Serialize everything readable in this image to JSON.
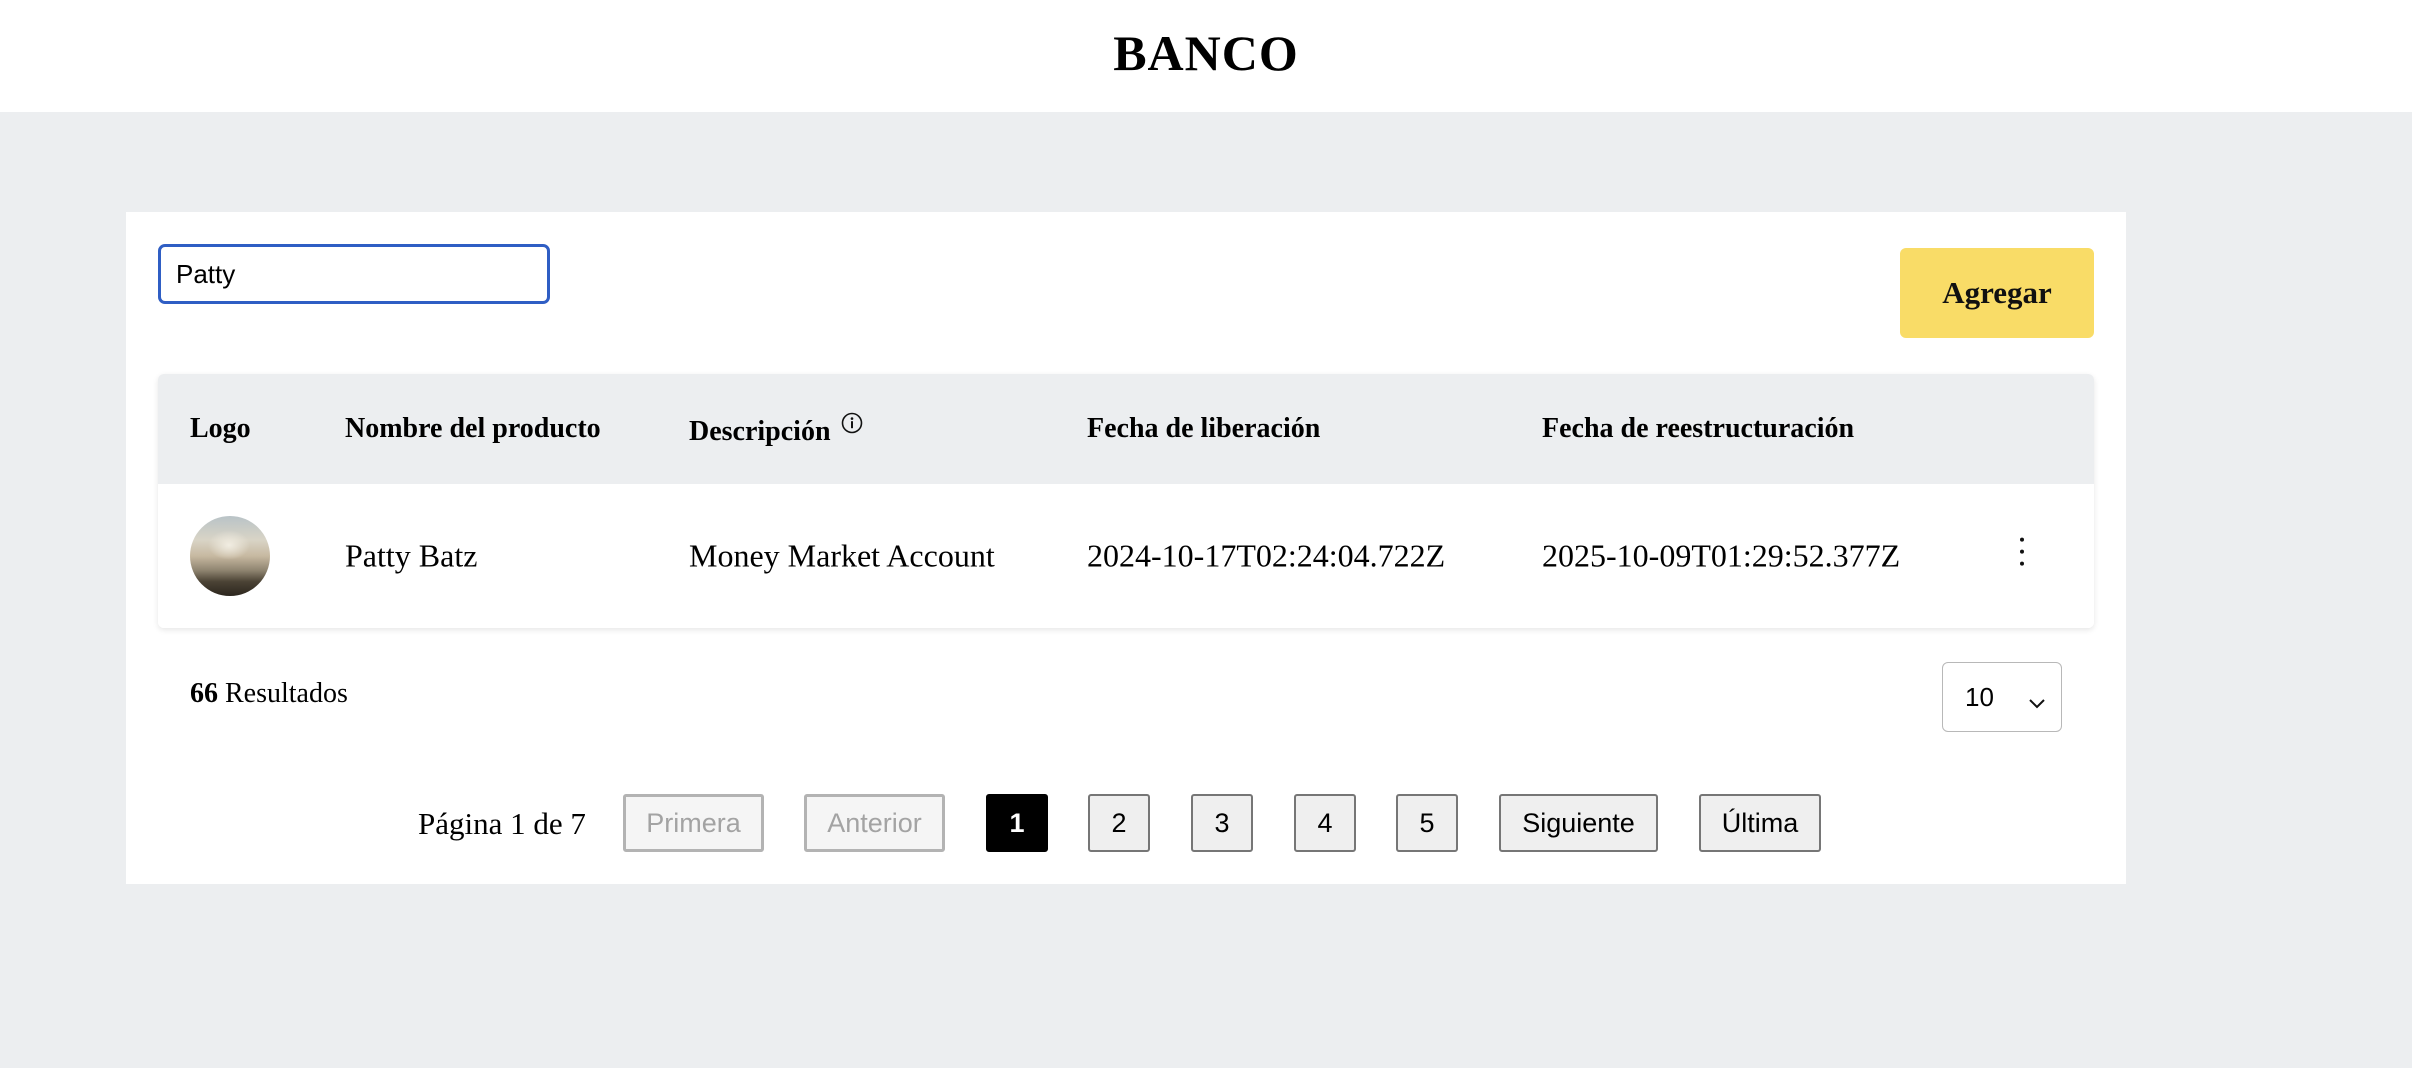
{
  "header": {
    "brand": "BANCO"
  },
  "search": {
    "value": "Patty",
    "placeholder": ""
  },
  "toolbar": {
    "add_label": "Agregar"
  },
  "table": {
    "columns": {
      "logo": "Logo",
      "name": "Nombre del producto",
      "description": "Descripción",
      "release_date": "Fecha de liberación",
      "restructure_date": "Fecha de reestructuración"
    },
    "rows": [
      {
        "name": "Patty Batz",
        "description": "Money Market Account",
        "release_date": "2024-10-17T02:24:04.722Z",
        "restructure_date": "2025-10-09T01:29:52.377Z"
      }
    ]
  },
  "results": {
    "count": "66",
    "label": "Resultados"
  },
  "page_size": {
    "value": "10"
  },
  "pagination": {
    "info": "Página 1 de 7",
    "first": "Primera",
    "previous": "Anterior",
    "pages": [
      "1",
      "2",
      "3",
      "4",
      "5"
    ],
    "current": "1",
    "next": "Siguiente",
    "last": "Última"
  },
  "colors": {
    "accent": "#f9dc67",
    "focus": "#2f5ec4",
    "background": "#eceef0"
  },
  "icons": {
    "info": "info-icon",
    "row_menu": "more-vertical-icon",
    "select": "chevron-down-icon"
  }
}
